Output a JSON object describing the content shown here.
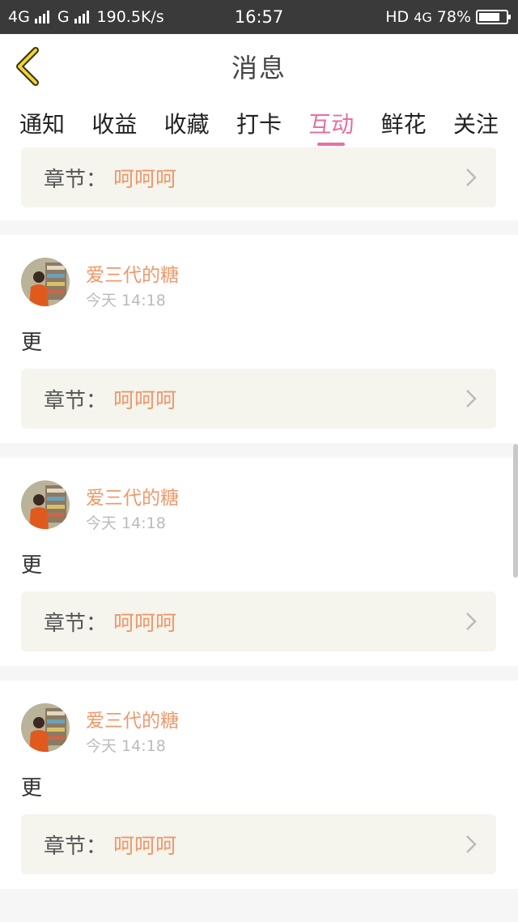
{
  "status_bar": {
    "network_1": "4G",
    "network_2": "G",
    "speed": "190.5K/s",
    "time": "16:57",
    "hd": "HD",
    "network_3": "4G",
    "battery": "78%",
    "battery_level": 0.78
  },
  "header": {
    "title": "消息",
    "back_icon": "chevron-left-icon"
  },
  "tabs": [
    {
      "label": "通知",
      "active": false
    },
    {
      "label": "收益",
      "active": false
    },
    {
      "label": "收藏",
      "active": false
    },
    {
      "label": "打卡",
      "active": false
    },
    {
      "label": "互动",
      "active": true
    },
    {
      "label": "鲜花",
      "active": false
    },
    {
      "label": "关注",
      "active": false
    }
  ],
  "messages": {
    "partial": {
      "chapter_label": "章节：",
      "chapter_name": "呵呵呵"
    },
    "items": [
      {
        "username": "爱三代的糖",
        "time": "今天 14:18",
        "comment": "更",
        "chapter_label": "章节：",
        "chapter_name": "呵呵呵"
      },
      {
        "username": "爱三代的糖",
        "time": "今天 14:18",
        "comment": "更",
        "chapter_label": "章节：",
        "chapter_name": "呵呵呵"
      },
      {
        "username": "爱三代的糖",
        "time": "今天 14:18",
        "comment": "更",
        "chapter_label": "章节：",
        "chapter_name": "呵呵呵"
      }
    ]
  },
  "colors": {
    "accent_pink": "#e76fa1",
    "accent_orange": "#f0986a",
    "status_bar_bg": "#3a3a3a",
    "chapter_bg": "#f5f4ed"
  }
}
